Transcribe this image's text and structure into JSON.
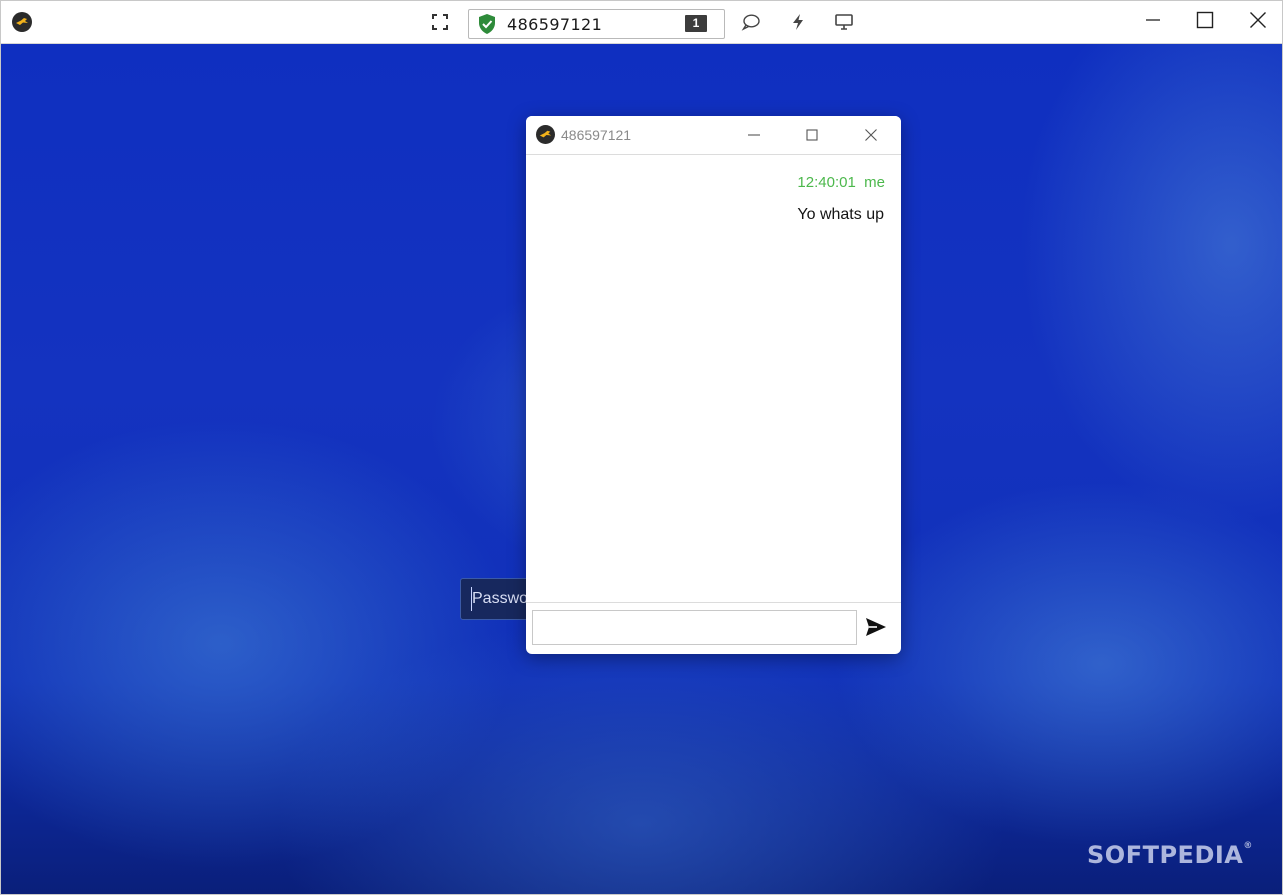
{
  "toolbar": {
    "session_id": "486597121",
    "session_count": "1",
    "icons": [
      "app-logo-icon",
      "fullscreen-icon",
      "shield-check-icon",
      "chat-icon",
      "lightning-icon",
      "monitor-icon",
      "minimize-icon",
      "maximize-icon",
      "close-icon"
    ],
    "shield_color": "#2e8b3a"
  },
  "desktop": {
    "password_placeholder": "Passwo",
    "watermark": "SOFTPEDIA",
    "watermark_mark": "®"
  },
  "chat": {
    "title": "486597121",
    "messages": [
      {
        "time": "12:40:01",
        "sender": "me",
        "text": "Yo whats up"
      }
    ],
    "input_value": "",
    "meta_color": "#4cb84c"
  }
}
